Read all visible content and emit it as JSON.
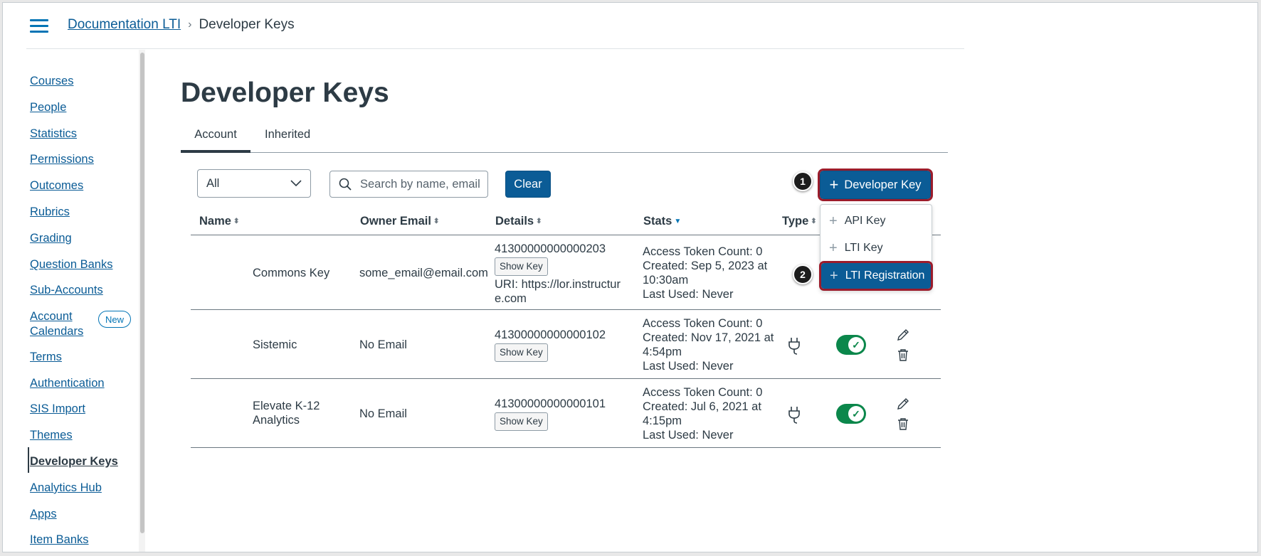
{
  "breadcrumb": {
    "parent": "Documentation LTI",
    "current": "Developer Keys"
  },
  "sidebar": {
    "items": [
      {
        "label": "Courses"
      },
      {
        "label": "People"
      },
      {
        "label": "Statistics"
      },
      {
        "label": "Permissions"
      },
      {
        "label": "Outcomes"
      },
      {
        "label": "Rubrics"
      },
      {
        "label": "Grading"
      },
      {
        "label": "Question Banks"
      },
      {
        "label": "Sub-Accounts"
      },
      {
        "label": "Account",
        "label2": "Calendars",
        "badge": "New"
      },
      {
        "label": "Terms"
      },
      {
        "label": "Authentication"
      },
      {
        "label": "SIS Import"
      },
      {
        "label": "Themes"
      },
      {
        "label": "Developer Keys",
        "active": true
      },
      {
        "label": "Analytics Hub"
      },
      {
        "label": "Apps"
      },
      {
        "label": "Item Banks"
      }
    ]
  },
  "page": {
    "title": "Developer Keys"
  },
  "tabs": [
    {
      "label": "Account",
      "active": true
    },
    {
      "label": "Inherited"
    }
  ],
  "filters": {
    "select_value": "All",
    "search_placeholder": "Search by name, email, or ID",
    "clear_label": "Clear"
  },
  "add_button": {
    "label": "Developer Key"
  },
  "menu": {
    "items": [
      {
        "label": "API Key"
      },
      {
        "label": "LTI Key"
      },
      {
        "label": "LTI Registration"
      }
    ]
  },
  "callouts": [
    "1",
    "2"
  ],
  "table": {
    "headers": [
      "Name",
      "Owner Email",
      "Details",
      "Stats",
      "Type"
    ],
    "rows": [
      {
        "name": "Commons Key",
        "email": "some_email@email.com",
        "id": "41300000000000203",
        "show_key": "Show Key",
        "uri": "URI: https://lor.instructure.com",
        "stat1": "Access Token Count: 0",
        "stat2": "Created: Sep 5, 2023 at 10:30am",
        "stat3": "Last Used: Never"
      },
      {
        "name": "Sistemic",
        "email": "No Email",
        "id": "41300000000000102",
        "show_key": "Show Key",
        "stat1": "Access Token Count: 0",
        "stat2": "Created: Nov 17, 2021 at 4:54pm",
        "stat3": "Last Used: Never",
        "type_icon": "plug-icon",
        "enabled": true
      },
      {
        "name": "Elevate K-12 Analytics",
        "email": "No Email",
        "id": "41300000000000101",
        "show_key": "Show Key",
        "stat1": "Access Token Count: 0",
        "stat2": "Created: Jul 6, 2021 at 4:15pm",
        "stat3": "Last Used: Never",
        "type_icon": "plug-icon",
        "enabled": true
      }
    ]
  },
  "colors": {
    "primary": "#0b5c96",
    "highlight_outline": "#9b1c2b",
    "toggle_on": "#0b874b"
  }
}
